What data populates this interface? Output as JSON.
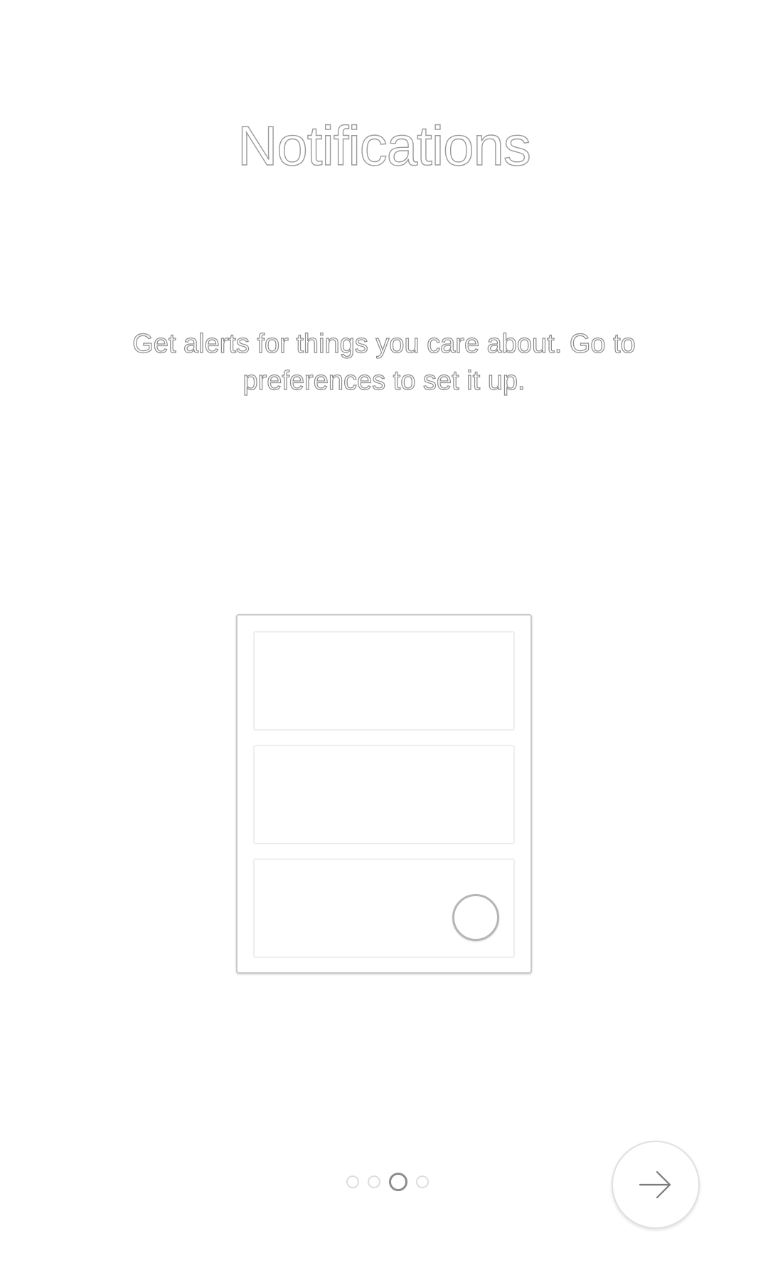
{
  "onboarding": {
    "title": "Notifications",
    "description": "Get alerts for things you care about. Go to preferences to set it up."
  },
  "pager": {
    "page_count": 4,
    "current_page": 3
  },
  "icons": {
    "next": "arrow-right-icon",
    "illustration": "notification-cards-illustration"
  },
  "colors": {
    "background": "#ffffff",
    "outline": "#9a9a9a",
    "dot_inactive": "#dcdcdc",
    "dot_active": "#8c8c8c"
  }
}
